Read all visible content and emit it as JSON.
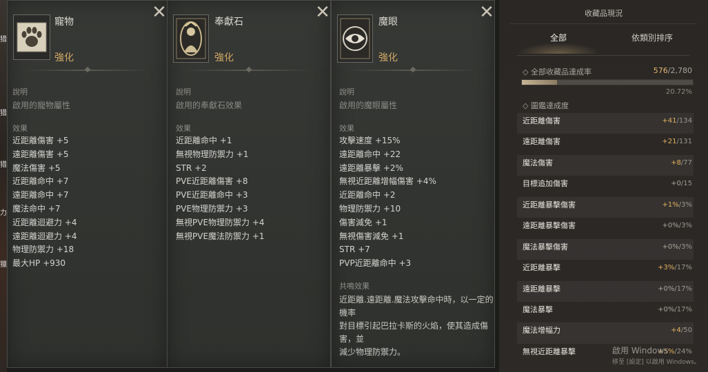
{
  "edge": {
    "chars": [
      "猎",
      "猎",
      "猎",
      "力",
      "獵"
    ]
  },
  "panels": [
    {
      "title": "寵物",
      "subtitle": "強化",
      "desc_label": "說明",
      "desc_text": "啟用的寵物屬性",
      "effect_label": "效果",
      "effects": [
        "近距離傷害 +5",
        "遠距離傷害 +5",
        "魔法傷害 +5",
        "近距離命中 +7",
        "遠距離命中 +7",
        "魔法命中 +7",
        "近距離迴避力 +4",
        "遠距離迴避力 +4",
        "物理防禦力 +18",
        "最大HP +930"
      ]
    },
    {
      "title": "奉獻石",
      "subtitle": "強化",
      "desc_label": "說明",
      "desc_text": "啟用的奉獻石效果",
      "effect_label": "效果",
      "effects": [
        "近距離命中 +1",
        "無視物理防禦力 +1",
        "STR +2",
        "PVE近距離傷害 +8",
        "PVE近距離命中 +3",
        "PVE物理防禦力 +3",
        "無視PVE物理防禦力 +4",
        "無視PVE魔法防禦力 +1"
      ]
    },
    {
      "title": "魔眼",
      "subtitle": "強化",
      "desc_label": "說明",
      "desc_text": "啟用的魔眼屬性",
      "effect_label": "效果",
      "effects": [
        "攻擊速度 +15%",
        "遠距離命中 +22",
        "遠距離暴擊 +2%",
        "無視近距離增幅傷害 +4%",
        "近距離命中 +2",
        "物理防禦力 +10",
        "傷害減免 +1",
        "無視傷害減免 +1",
        "STR +7",
        "PVP近距離命中 +3"
      ],
      "resonance_label": "共鳴效果",
      "resonance_text": "近距離.遠距離.魔法攻擊命中時，以一定的機率\n對目標引起巴拉卡斯的火焰，使其造成傷害，並\n減少物理防禦力。"
    }
  ],
  "collection": {
    "title": "收藏品現況",
    "tabs": {
      "all": "全部",
      "by_category": "依類別排序"
    },
    "overall_label": "◇ 全部收藏品達成率",
    "overall_current": "576",
    "overall_total": "/2,780",
    "overall_fraction": 0.2072,
    "overall_percent": "20.72%",
    "codex_label": "◇ 圖鑑達成度",
    "rows": [
      {
        "name": "近距離傷害",
        "cur": "+41",
        "max": "/134"
      },
      {
        "name": "遠距離傷害",
        "cur": "+21",
        "max": "/131"
      },
      {
        "name": "魔法傷害",
        "cur": "+8",
        "max": "/77"
      },
      {
        "name": "目標追加傷害",
        "cur": "+0",
        "max": "/15"
      },
      {
        "name": "近距離暴擊傷害",
        "cur": "+1%",
        "max": "/3%"
      },
      {
        "name": "遠距離暴擊傷害",
        "cur": "+0%",
        "max": "/3%"
      },
      {
        "name": "魔法暴擊傷害",
        "cur": "+0%",
        "max": "/3%"
      },
      {
        "name": "近距離暴擊",
        "cur": "+3%",
        "max": "/17%"
      },
      {
        "name": "遠距離暴擊",
        "cur": "+0%",
        "max": "/17%"
      },
      {
        "name": "魔法暴擊",
        "cur": "+0%",
        "max": "/17%"
      },
      {
        "name": "魔法增幅力",
        "cur": "+4",
        "max": "/50"
      },
      {
        "name": "無視近距離暴擊",
        "cur": "+5%",
        "max": "/24%"
      }
    ]
  },
  "watermark": {
    "line1": "啟用 Windows",
    "line2": "移至 [設定] 以啟用 Windows。"
  }
}
